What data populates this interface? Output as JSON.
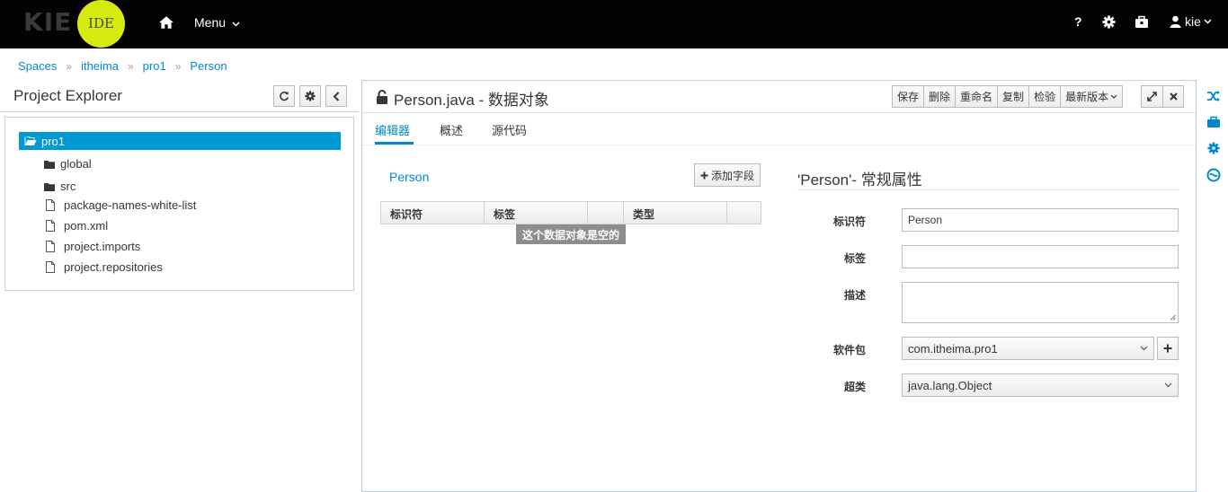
{
  "brand": {
    "kie": "KIE",
    "ide": "IDE"
  },
  "nav": {
    "menu_label": "Menu",
    "help_label": "?",
    "user_label": "kie"
  },
  "breadcrumb": [
    "Spaces",
    "itheima",
    "pro1",
    "Person"
  ],
  "explorer": {
    "title": "Project Explorer",
    "tree": [
      {
        "label": "pro1",
        "type": "folder-open",
        "selected": true
      },
      {
        "label": "global",
        "type": "folder"
      },
      {
        "label": "src",
        "type": "folder"
      },
      {
        "label": "package-names-white-list",
        "type": "file"
      },
      {
        "label": "pom.xml",
        "type": "file"
      },
      {
        "label": "project.imports",
        "type": "file"
      },
      {
        "label": "project.repositories",
        "type": "file"
      }
    ]
  },
  "editor": {
    "title": "Person.java - 数据对象",
    "buttons": [
      "保存",
      "删除",
      "重命名",
      "复制",
      "检验",
      "最新版本"
    ],
    "tabs": [
      "编辑器",
      "概述",
      "源代码"
    ],
    "object_name": "Person",
    "add_field_label": "添加字段",
    "table_headers": [
      "标识符",
      "标签",
      "类型"
    ],
    "empty_message": "这个数据对象是空的",
    "properties": {
      "title": "'Person'- 常规属性",
      "identifier_label": "标识符",
      "identifier_value": "Person",
      "label_label": "标签",
      "label_value": "",
      "description_label": "描述",
      "description_value": "",
      "package_label": "软件包",
      "package_value": "com.itheima.pro1",
      "superclass_label": "超类",
      "superclass_value": "java.lang.Object"
    }
  },
  "colors": {
    "accent": "#0088ce",
    "selected_bg": "#0099d3",
    "topbar": "#030303",
    "logo_circle": "#d6ea10"
  }
}
